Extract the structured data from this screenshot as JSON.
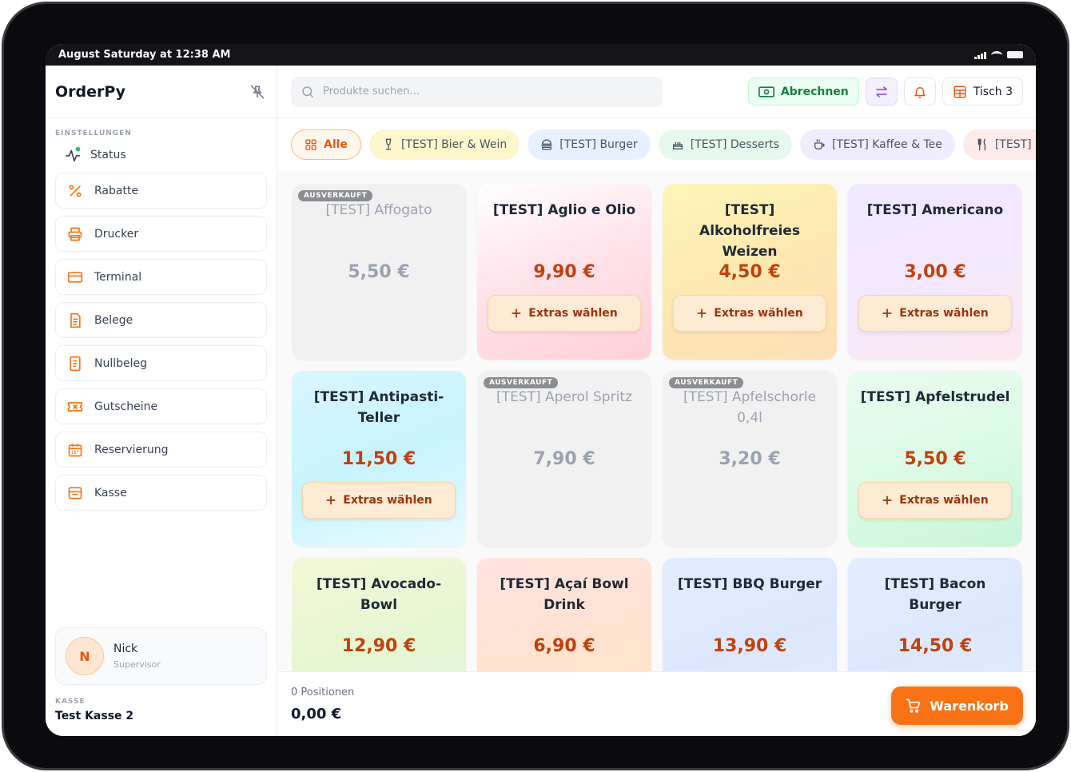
{
  "statusbar": {
    "time": "August Saturday at 12:38 AM"
  },
  "sidebar": {
    "brand": "OrderPy",
    "section_label": "EINSTELLUNGEN",
    "status_label": "Status",
    "items": [
      {
        "label": "Rabatte",
        "icon": "percent-icon"
      },
      {
        "label": "Drucker",
        "icon": "printer-icon"
      },
      {
        "label": "Terminal",
        "icon": "card-icon"
      },
      {
        "label": "Belege",
        "icon": "receipt-icon"
      },
      {
        "label": "Nullbeleg",
        "icon": "document-icon"
      },
      {
        "label": "Gutscheine",
        "icon": "ticket-icon"
      },
      {
        "label": "Reservierung",
        "icon": "calendar-icon"
      },
      {
        "label": "Kasse",
        "icon": "register-icon"
      }
    ],
    "user": {
      "initial": "N",
      "name": "Nick",
      "role": "Supervisor"
    },
    "kasse_label": "KASSE",
    "kasse_name": "Test Kasse 2"
  },
  "topbar": {
    "search_placeholder": "Produkte suchen...",
    "abrechnen_label": "Abrechnen",
    "table_label": "Tisch 3"
  },
  "categories": [
    {
      "label": "Alle",
      "icon": "grid-icon"
    },
    {
      "label": "[TEST] Bier & Wein",
      "icon": "wine-icon"
    },
    {
      "label": "[TEST] Burger",
      "icon": "burger-icon"
    },
    {
      "label": "[TEST] Desserts",
      "icon": "cake-icon"
    },
    {
      "label": "[TEST] Kaffee & Tee",
      "icon": "coffee-icon"
    },
    {
      "label": "[TEST] Pasta",
      "icon": "utensils-icon"
    }
  ],
  "extras_label": "Extras wählen",
  "soldout_label": "AUSVERKAUFT",
  "products": [
    {
      "name": "[TEST] Affogato",
      "price": "5,50 €",
      "soldout": true
    },
    {
      "name": "[TEST] Aglio e Olio",
      "price": "9,90 €",
      "soldout": false
    },
    {
      "name": "[TEST] Alkoholfreies Weizen",
      "price": "4,50 €",
      "soldout": false
    },
    {
      "name": "[TEST] Americano",
      "price": "3,00 €",
      "soldout": false
    },
    {
      "name": "[TEST] Antipasti-Teller",
      "price": "11,50 €",
      "soldout": false
    },
    {
      "name": "[TEST] Aperol Spritz",
      "price": "7,90 €",
      "soldout": true
    },
    {
      "name": "[TEST] Apfelschorle 0,4l",
      "price": "3,20 €",
      "soldout": true
    },
    {
      "name": "[TEST] Apfelstrudel",
      "price": "5,50 €",
      "soldout": false
    },
    {
      "name": "[TEST] Avocado-Bowl",
      "price": "12,90 €",
      "soldout": false
    },
    {
      "name": "[TEST] Açaí Bowl Drink",
      "price": "6,90 €",
      "soldout": false
    },
    {
      "name": "[TEST] BBQ Burger",
      "price": "13,90 €",
      "soldout": false
    },
    {
      "name": "[TEST] Bacon Burger",
      "price": "14,50 €",
      "soldout": false
    }
  ],
  "bottom": {
    "positions": "0 Positionen",
    "total": "0,00 €",
    "cart_label": "Warenkorb"
  },
  "colors": {
    "accent": "#f97316",
    "price": "#c2410c",
    "success": "#15803d"
  }
}
